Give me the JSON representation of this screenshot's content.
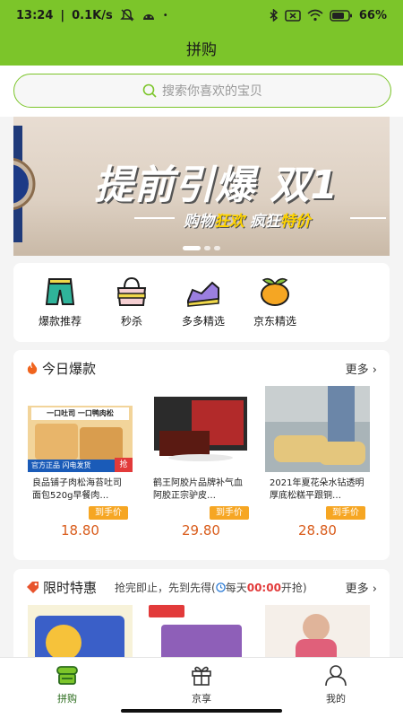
{
  "status": {
    "time": "13:24",
    "speed": "0.1K/s",
    "battery": "66"
  },
  "header": {
    "title": "拼购"
  },
  "search": {
    "placeholder": "搜索你喜欢的宝贝"
  },
  "banner": {
    "line1": "提前引爆 双1",
    "line2_part1": "购物",
    "line2_hl1": "狂欢",
    "line2_part2": " 疯狂",
    "line2_hl2": "特价",
    "dots": 3,
    "active_dot": 0
  },
  "categories": [
    {
      "label": "爆款推荐",
      "icon": "shorts-icon"
    },
    {
      "label": "秒杀",
      "icon": "handbag-icon"
    },
    {
      "label": "多多精选",
      "icon": "sneaker-icon"
    },
    {
      "label": "京东精选",
      "icon": "fruit-icon"
    }
  ],
  "hot": {
    "title": "今日爆款",
    "more": "更多",
    "items": [
      {
        "name": "良品铺子肉松海苔吐司面包520g早餐肉…",
        "tag": "到手价",
        "price": "18.80",
        "img_top": "一口吐司 一口鸭肉松",
        "img_bottom": "官方正品 闪电发货",
        "img_corner": "抢"
      },
      {
        "name": "鹤王阿胶片品牌补气血阿胶正宗驴皮…",
        "tag": "到手价",
        "price": "29.80"
      },
      {
        "name": "2021年夏花朵水钻透明厚底松糕平跟铜…",
        "tag": "到手价",
        "price": "28.80"
      }
    ]
  },
  "limited": {
    "title": "限时特惠",
    "subtitle_pre": "抢完即止，先到先得(",
    "subtitle_mid": "每天",
    "subtitle_time": "00:00",
    "subtitle_post": "开抢)",
    "more": "更多"
  },
  "nav": [
    {
      "label": "拼购",
      "icon": "shop-icon",
      "active": true
    },
    {
      "label": "京享",
      "icon": "gift-icon",
      "active": false
    },
    {
      "label": "我的",
      "icon": "user-icon",
      "active": false
    }
  ],
  "colors": {
    "brand": "#7cc52a",
    "price": "#d95c1b",
    "tag": "#f6a623"
  }
}
